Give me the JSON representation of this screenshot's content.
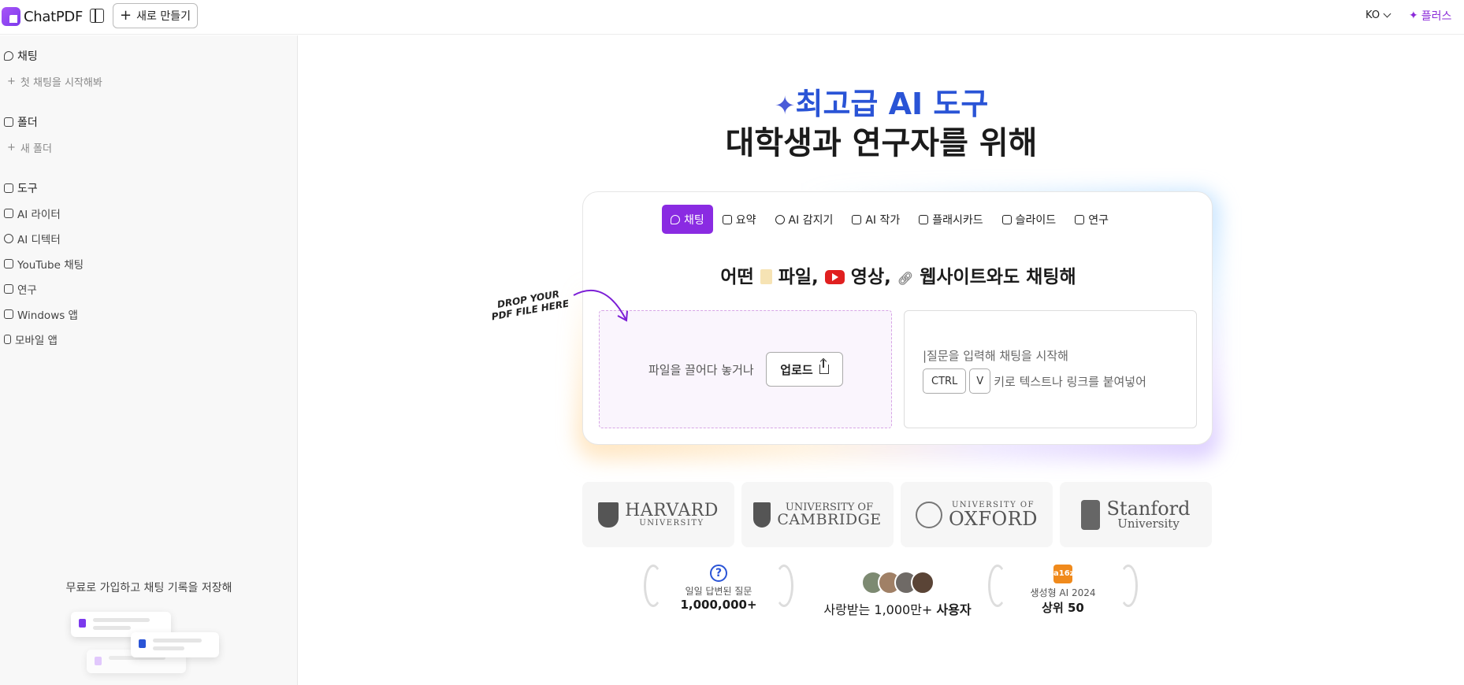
{
  "app": {
    "name": "ChatPDF"
  },
  "topbar": {
    "new_label": "새로 만들기",
    "lang": "KO",
    "plus_label": "플러스"
  },
  "sidebar": {
    "chat_header": "채팅",
    "chat_start": "첫 채팅을 시작해봐",
    "folder_header": "폴더",
    "new_folder": "새 폴더",
    "tools_header": "도구",
    "tools": [
      {
        "label": "AI 라이터",
        "icon": "edit-icon"
      },
      {
        "label": "AI 디텍터",
        "icon": "glasses-icon"
      },
      {
        "label": "YouTube 채팅",
        "icon": "youtube-icon"
      },
      {
        "label": "연구",
        "icon": "graduation-cap-icon"
      },
      {
        "label": "Windows 앱",
        "icon": "download-icon"
      },
      {
        "label": "모바일 앱",
        "icon": "phone-icon"
      }
    ],
    "signup_text": "무료로 가입하고 채팅 기록을 저장해"
  },
  "hero": {
    "line1": "최고급 AI 도구",
    "line2": "대학생과 연구자를 위해"
  },
  "tabs": [
    {
      "label": "채팅",
      "active": true
    },
    {
      "label": "요약"
    },
    {
      "label": "AI 감지기"
    },
    {
      "label": "AI 작가"
    },
    {
      "label": "플래시카드"
    },
    {
      "label": "슬라이드"
    },
    {
      "label": "연구"
    }
  ],
  "card": {
    "title_part1": "어떤",
    "title_part2": "파일,",
    "title_part3": "영상,",
    "title_part4": "웹사이트와도 채팅해",
    "drop_text": "파일을 끌어다 놓거나",
    "upload_label": "업로드",
    "drop_hint_line1": "DROP YOUR",
    "drop_hint_line2": "PDF FILE HERE",
    "chat_placeholder": "|질문을 입력해 채팅을 시작해",
    "key_ctrl": "CTRL",
    "key_v": "V",
    "paste_hint": "키로 텍스트나 링크를 붙여넣어"
  },
  "universities": [
    {
      "big": "HARVARD",
      "small": "UNIVERSITY"
    },
    {
      "small": "UNIVERSITY OF",
      "big": "CAMBRIDGE"
    },
    {
      "small": "UNIVERSITY OF",
      "big": "OXFORD"
    },
    {
      "big": "Stanford",
      "small": "University"
    }
  ],
  "stats": {
    "answered_label": "일일 답변된 질문",
    "answered_value": "1,000,000+",
    "users_text_prefix": "사랑받는",
    "users_text_value": "1,000만+",
    "users_text_suffix": "사용자",
    "a16z_label": "a16z",
    "award_label": "생성형 AI 2024",
    "award_value": "상위 50"
  },
  "colors": {
    "accent": "#8a2be2",
    "hero_blue": "#2a54d6",
    "plus": "#8b2bd9"
  }
}
